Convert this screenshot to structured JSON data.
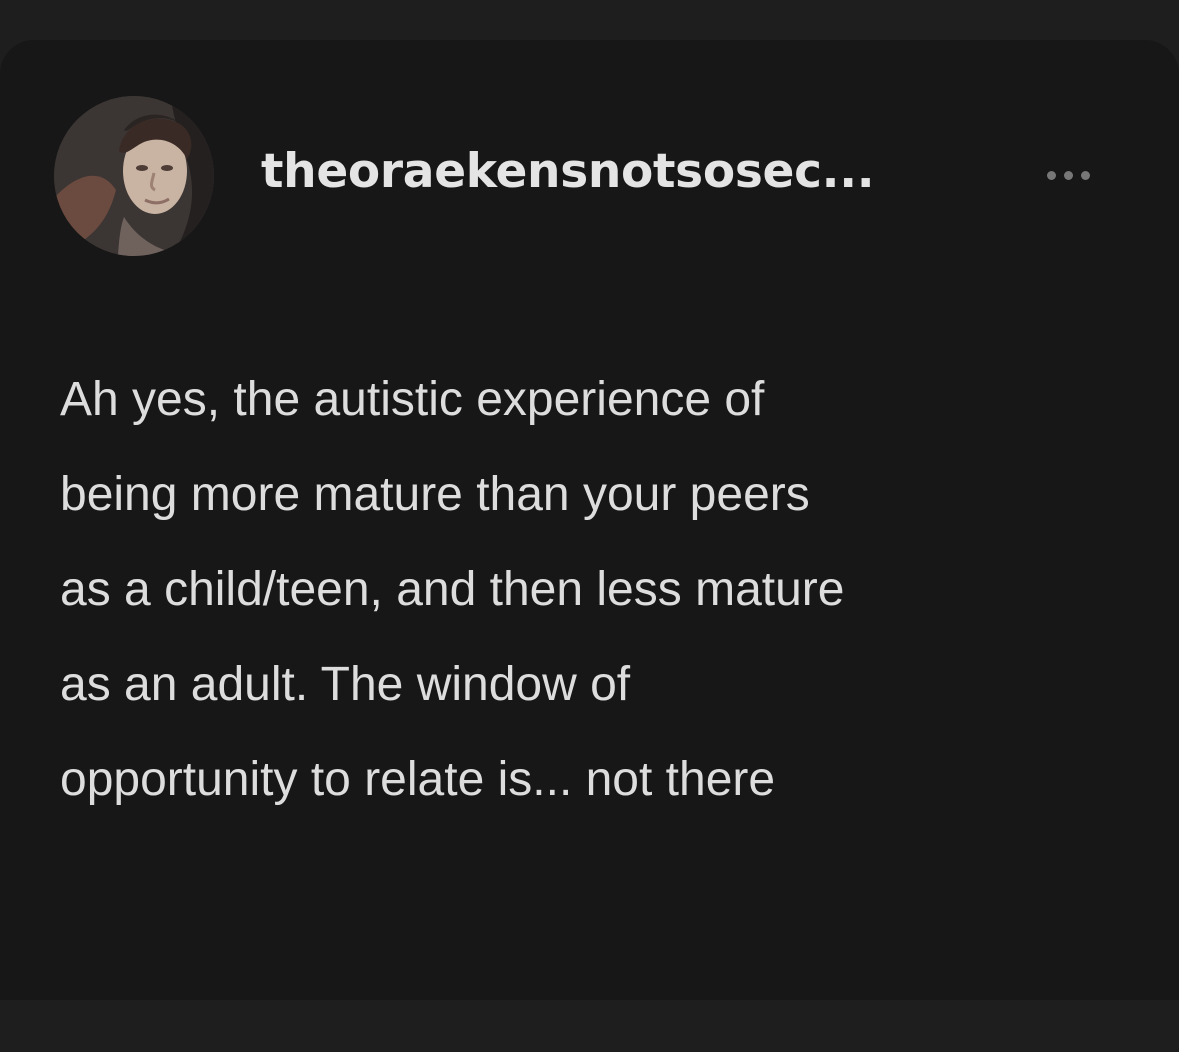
{
  "post": {
    "username": "theoraekensnotsosec...",
    "avatar": {
      "icon": "profile-photo",
      "colors": [
        "#3b3533",
        "#c9b3a3",
        "#6b4a3f",
        "#242020"
      ]
    },
    "menu_icon": "more-horizontal-icon",
    "text_lines": [
      "Ah yes, the autistic experience of",
      "being more mature than your peers",
      "as a child/teen, and then less mature",
      "as an adult. The window of",
      "opportunity to relate is... not there"
    ]
  },
  "colors": {
    "background": "#1e1e1e",
    "card": "#171717",
    "text": "#dddddd",
    "username": "#e4e4e4",
    "icon": "#777777"
  }
}
